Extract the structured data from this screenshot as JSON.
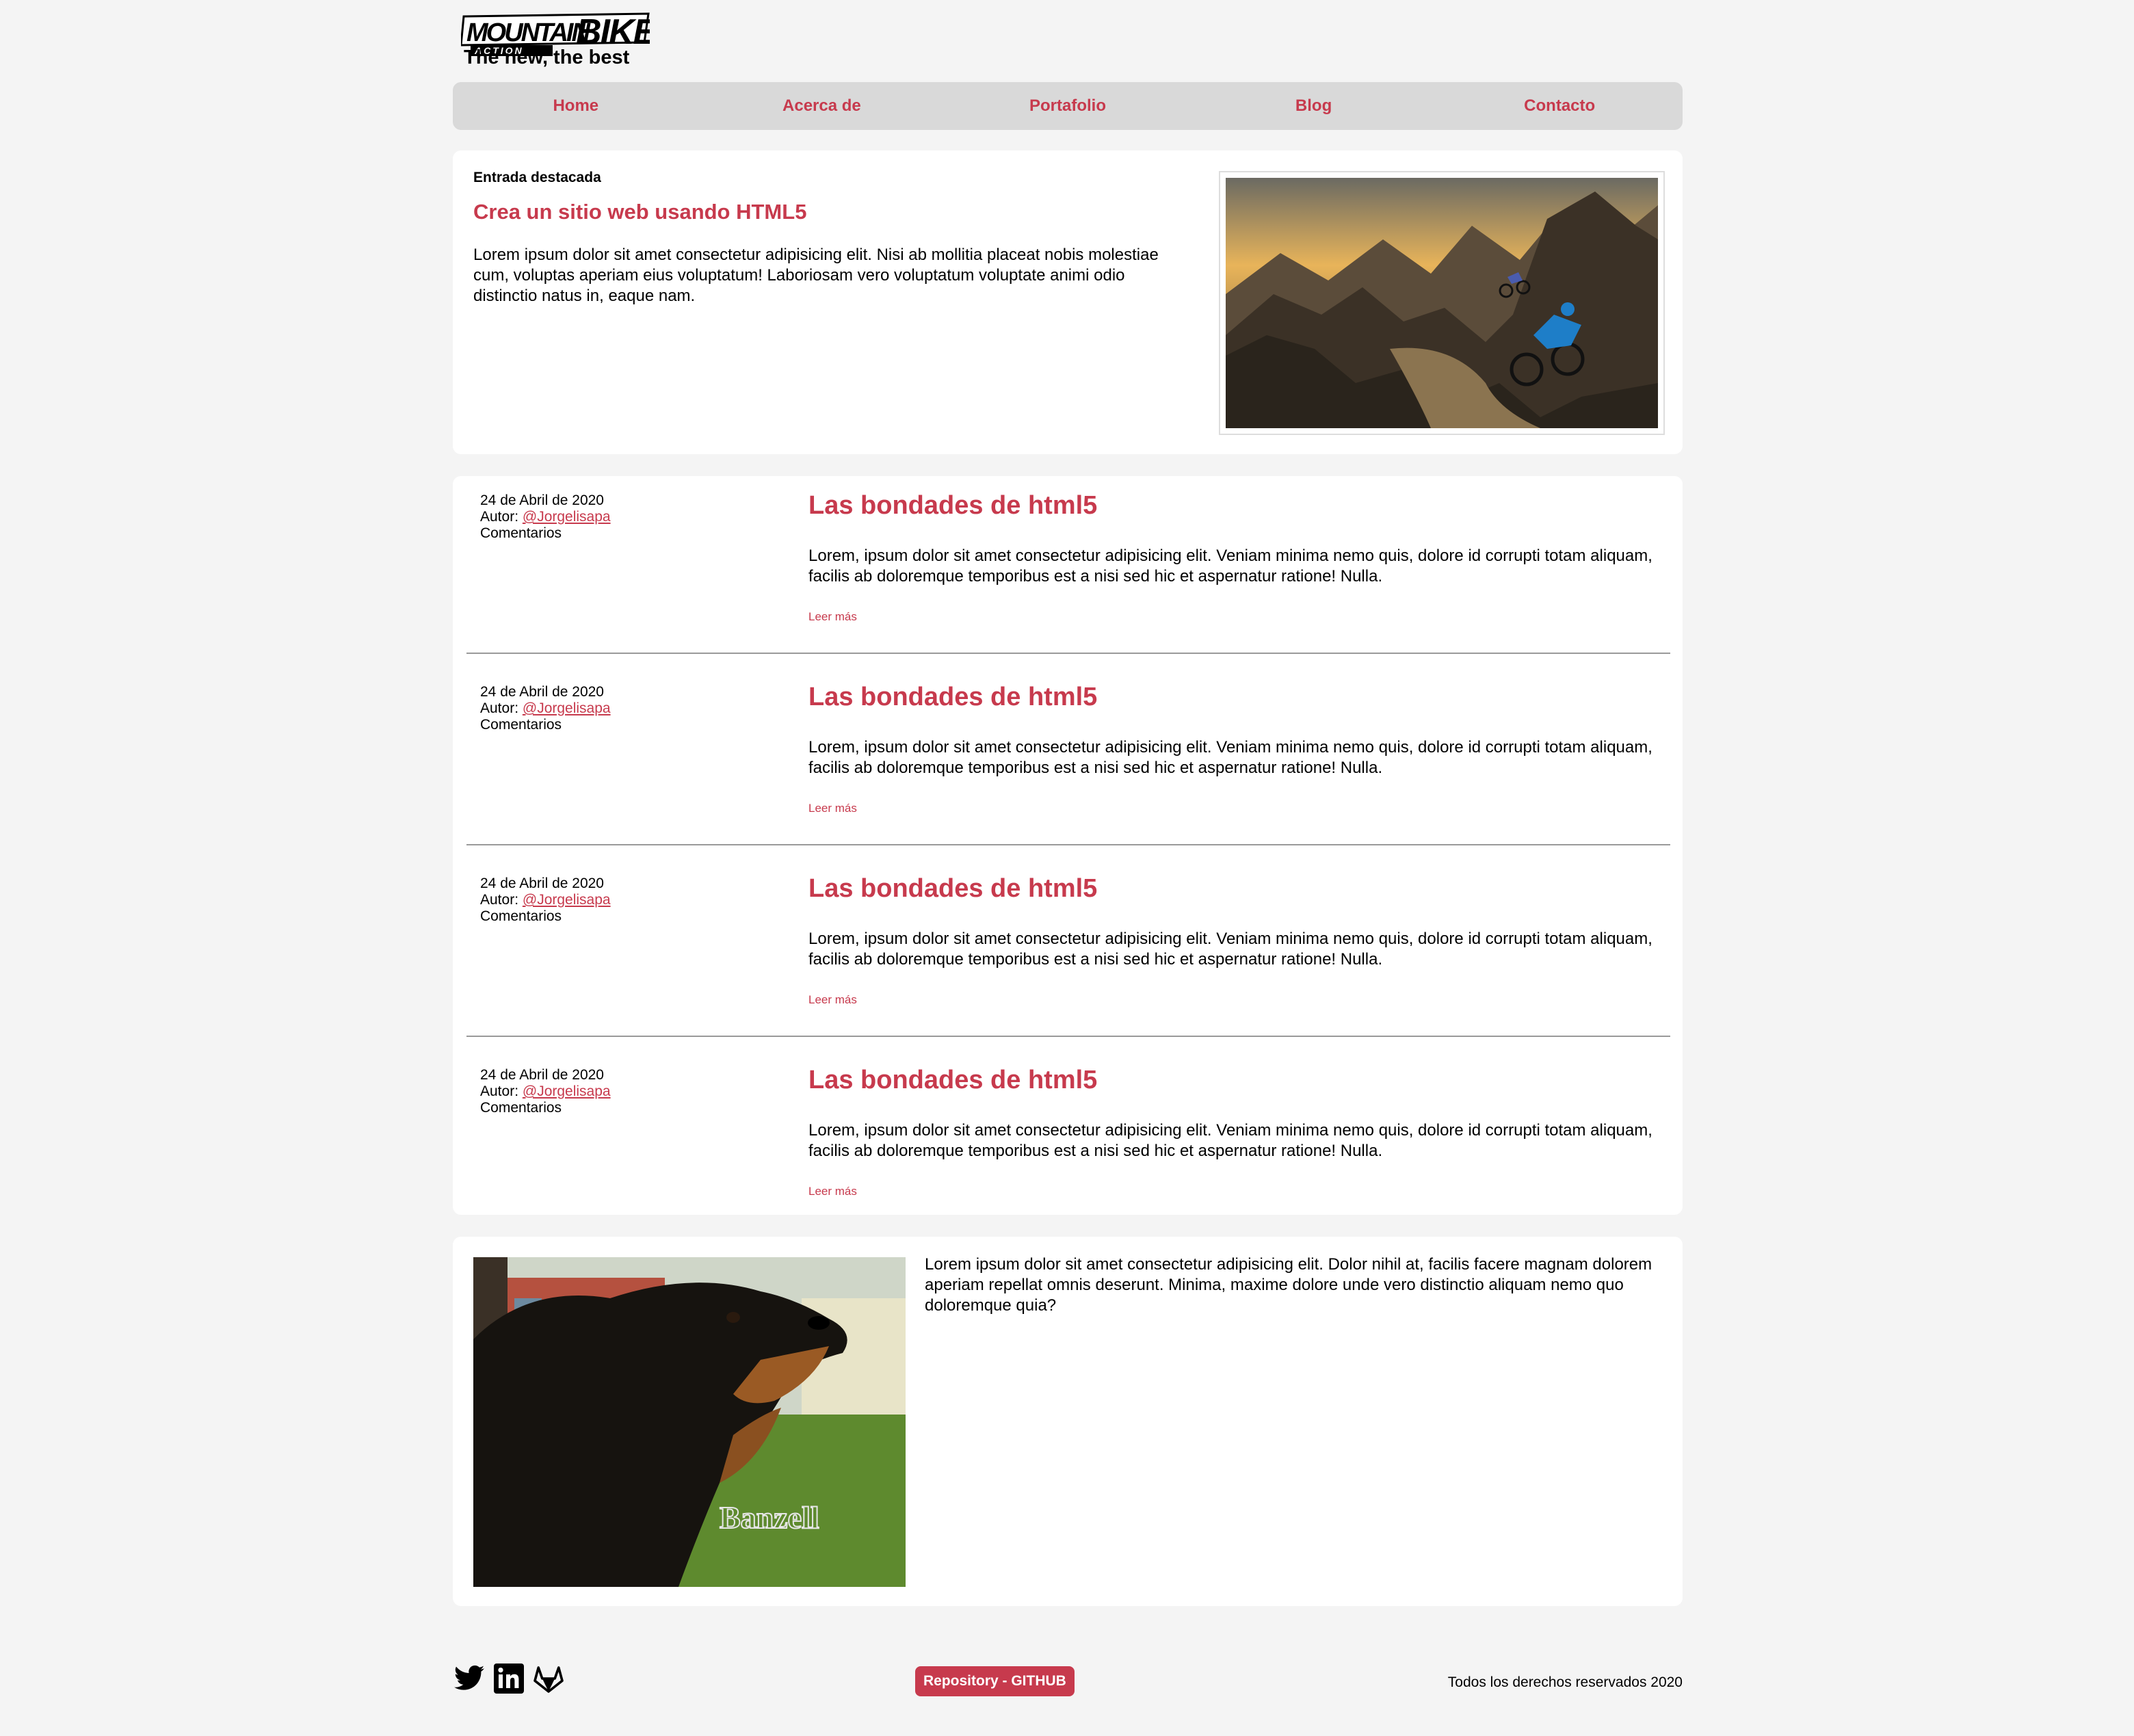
{
  "header": {
    "logo_main": "MOUNTAINBIKE",
    "logo_sub": "ACTION",
    "tagline": "The new, the best"
  },
  "nav": {
    "items": [
      "Home",
      "Acerca de",
      "Portafolio",
      "Blog",
      "Contacto"
    ],
    "accent": "#c73a4d"
  },
  "featured": {
    "label": "Entrada destacada",
    "title": "Crea un sitio web usando HTML5",
    "text": "Lorem ipsum dolor sit amet consectetur adipisicing elit. Nisi ab mollitia placeat nobis molestiae cum, voluptas aperiam eius voluptatum! Laboriosam vero voluptatum voluptate animi odio distinctio natus in, eaque nam."
  },
  "posts": [
    {
      "date": "24 de Abril de 2020",
      "author_label": "Autor:",
      "author": "@Jorgelisapa",
      "comments": "Comentarios",
      "title": "Las bondades de html5",
      "text": "Lorem, ipsum dolor sit amet consectetur adipisicing elit. Veniam minima nemo quis, dolore id corrupti totam aliquam, facilis ab doloremque temporibus est a nisi sed hic et aspernatur ratione! Nulla.",
      "more": "Leer más"
    },
    {
      "date": "24 de Abril de 2020",
      "author_label": "Autor:",
      "author": "@Jorgelisapa",
      "comments": "Comentarios",
      "title": "Las bondades de html5",
      "text": "Lorem, ipsum dolor sit amet consectetur adipisicing elit. Veniam minima nemo quis, dolore id corrupti totam aliquam, facilis ab doloremque temporibus est a nisi sed hic et aspernatur ratione! Nulla.",
      "more": "Leer más"
    },
    {
      "date": "24 de Abril de 2020",
      "author_label": "Autor:",
      "author": "@Jorgelisapa",
      "comments": "Comentarios",
      "title": "Las bondades de html5",
      "text": "Lorem, ipsum dolor sit amet consectetur adipisicing elit. Veniam minima nemo quis, dolore id corrupti totam aliquam, facilis ab doloremque temporibus est a nisi sed hic et aspernatur ratione! Nulla.",
      "more": "Leer más"
    },
    {
      "date": "24 de Abril de 2020",
      "author_label": "Autor:",
      "author": "@Jorgelisapa",
      "comments": "Comentarios",
      "title": "Las bondades de html5",
      "text": "Lorem, ipsum dolor sit amet consectetur adipisicing elit. Veniam minima nemo quis, dolore id corrupti totam aliquam, facilis ab doloremque temporibus est a nisi sed hic et aspernatur ratione! Nulla.",
      "more": "Leer más"
    }
  ],
  "bottom": {
    "image_caption": "Banzell",
    "text": "Lorem ipsum dolor sit amet consectetur adipisicing elit. Dolor nihil at, facilis facere magnam dolorem aperiam repellat omnis deserunt. Minima, maxime dolore unde vero distinctio aliquam nemo quo doloremque quia?"
  },
  "footer": {
    "social": [
      "twitter-icon",
      "linkedin-icon",
      "gitlab-icon"
    ],
    "repo_label": "Repository - GITHUB",
    "rights": "Todos los derechos reservados 2020"
  }
}
